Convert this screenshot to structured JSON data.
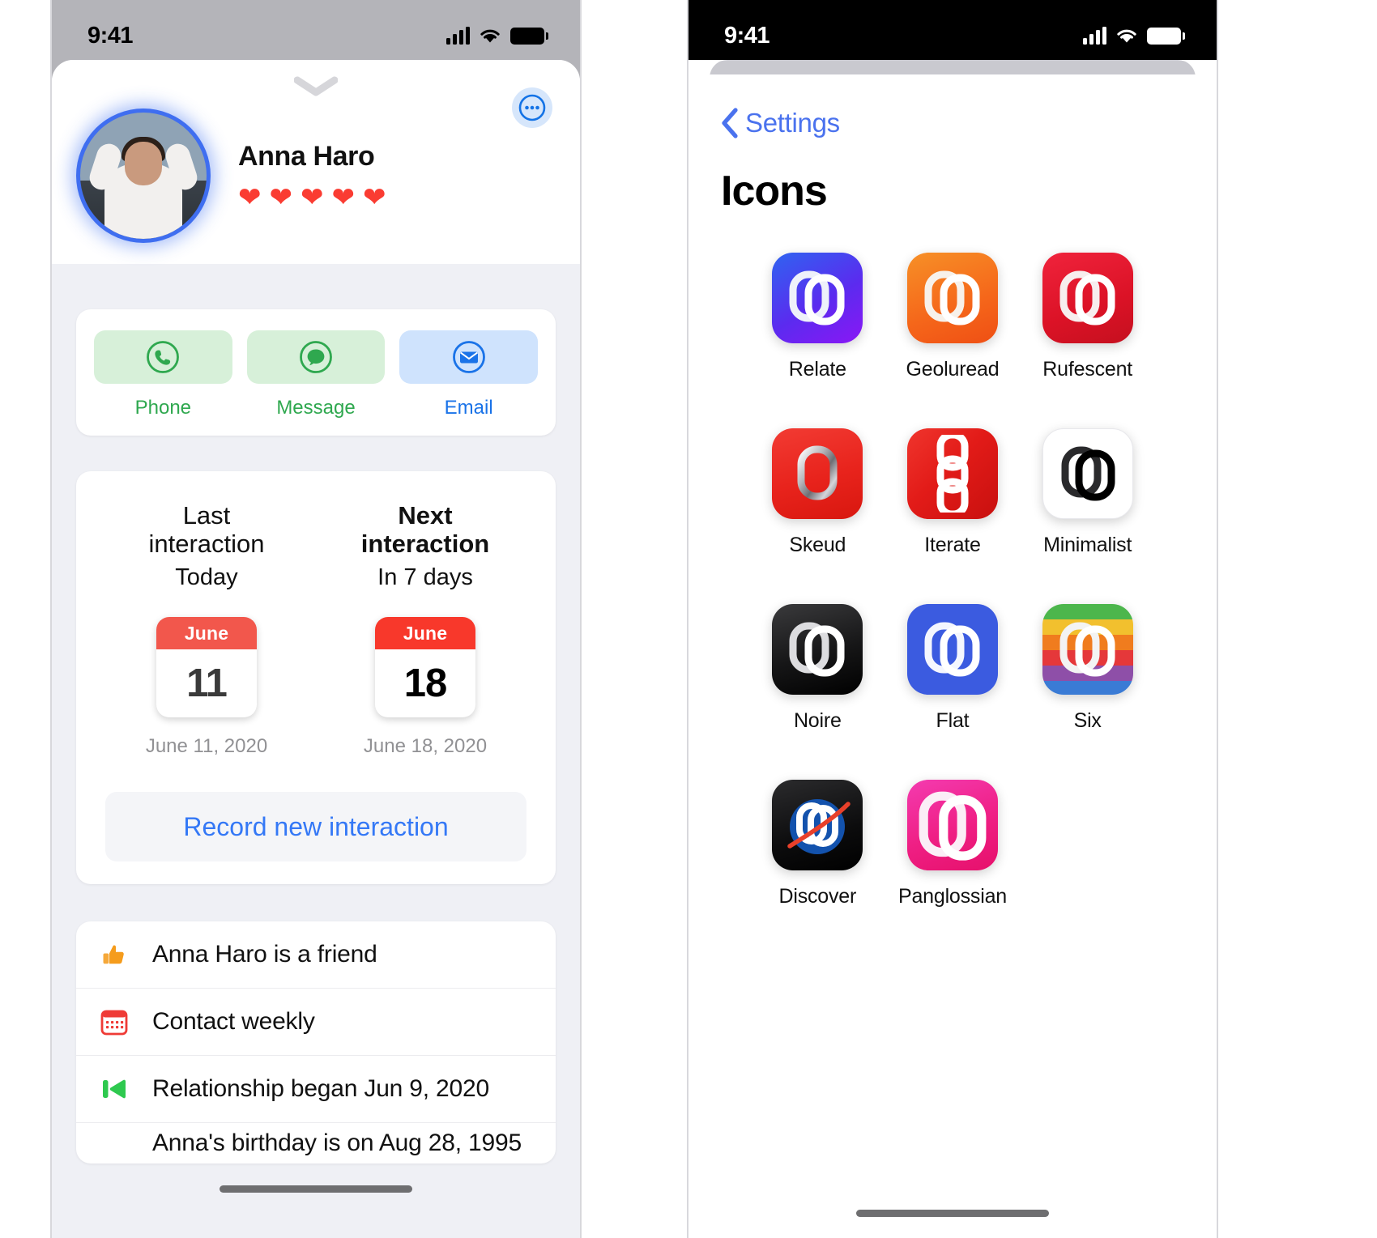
{
  "left_phone": {
    "status_bar": {
      "time": "9:41",
      "signal_icon": "cellular-signal-icon",
      "wifi_icon": "wifi-icon",
      "battery_icon": "battery-icon"
    },
    "grabber_icon": "chevron-down-grabber-icon",
    "more_button": {
      "icon": "ellipsis-circle-icon"
    },
    "profile": {
      "name": "Anna Haro",
      "avatar_icon": "contact-photo-avatar",
      "rating_hearts": 5,
      "heart_glyph": "❤",
      "heart_color": "#fa3c32"
    },
    "actions": [
      {
        "label": "Phone",
        "icon": "phone-circle-icon",
        "pill": "green",
        "text_color": "#2fa84f"
      },
      {
        "label": "Message",
        "icon": "message-circle-icon",
        "pill": "green",
        "text_color": "#2fa84f"
      },
      {
        "label": "Email",
        "icon": "envelope-circle-icon",
        "pill": "blue",
        "text_color": "#1a73e8"
      }
    ],
    "interactions": {
      "last": {
        "title_line1": "Last",
        "title_line2": "interaction",
        "relative": "Today",
        "month": "June",
        "day": "11",
        "full_date": "June 11, 2020",
        "emphasis": false
      },
      "next": {
        "title_line1": "Next",
        "title_line2": "interaction",
        "relative": "In 7 days",
        "month": "June",
        "day": "18",
        "full_date": "June 18, 2020",
        "emphasis": true
      },
      "record_button": "Record new interaction"
    },
    "facts": [
      {
        "icon": "thumbs-up-icon",
        "text": "Anna Haro is a friend"
      },
      {
        "icon": "calendar-icon",
        "text": "Contact weekly"
      },
      {
        "icon": "rewind-icon",
        "text": "Relationship began Jun 9, 2020"
      },
      {
        "icon": "gift-icon",
        "text": "Anna's birthday is on Aug 28, 1995"
      }
    ]
  },
  "right_phone": {
    "status_bar": {
      "time": "9:41",
      "signal_icon": "cellular-signal-icon",
      "wifi_icon": "wifi-icon",
      "battery_icon": "battery-icon"
    },
    "back": {
      "label": "Settings",
      "icon": "chevron-left-icon"
    },
    "title": "Icons",
    "app_icons": [
      {
        "label": "Relate",
        "style": "relate"
      },
      {
        "label": "Geoluread",
        "style": "geoluread"
      },
      {
        "label": "Rufescent",
        "style": "rufescent"
      },
      {
        "label": "Skeud",
        "style": "skeud"
      },
      {
        "label": "Iterate",
        "style": "iterate"
      },
      {
        "label": "Minimalist",
        "style": "minimalist"
      },
      {
        "label": "Noire",
        "style": "noire"
      },
      {
        "label": "Flat",
        "style": "flat"
      },
      {
        "label": "Six",
        "style": "six"
      },
      {
        "label": "Discover",
        "style": "discover"
      },
      {
        "label": "Panglossian",
        "style": "panglossian"
      }
    ]
  },
  "colors": {
    "accent_blue": "#3478f6",
    "green": "#2fa84f",
    "red": "#f8382b",
    "sheet_bg": "#eff0f5"
  }
}
